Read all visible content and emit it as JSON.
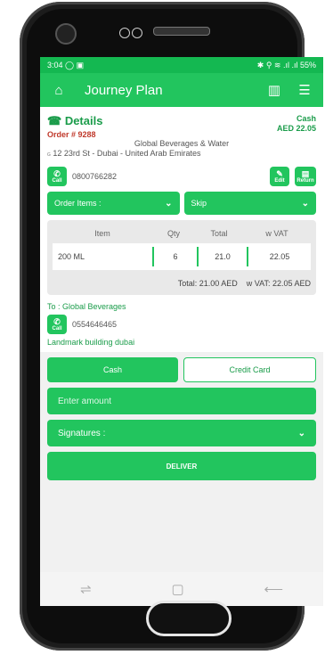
{
  "status_bar": {
    "time": "3:04",
    "left_icons": "◯ ▣",
    "right_text": "✱ ⚲ ≋ .ıl .ıl 55%"
  },
  "app_bar": {
    "title": "Journey Plan"
  },
  "details": {
    "title": "Details",
    "order_label": "Order # 9288",
    "payment_type": "Cash",
    "payment_amount": "AED 22.05",
    "customer": "Global Beverages & Water",
    "address_prefix": "G",
    "address": "12 23rd St - Dubai - United Arab Emirates",
    "phone": "0800766282",
    "call_label": "Call",
    "edit_label": "Edit",
    "return_label": "Return"
  },
  "dropdowns": {
    "order_items": "Order Items :",
    "skip": "Skip"
  },
  "items": {
    "headers": [
      "Item",
      "Qty",
      "Total",
      "w VAT"
    ],
    "rows": [
      {
        "item": "200 ML",
        "qty": "6",
        "total": "21.0",
        "vat": "22.05"
      }
    ],
    "total_text": "Total: 21.00 AED",
    "vat_text": "w VAT: 22.05 AED"
  },
  "recipient": {
    "to_label": "To : Global Beverages",
    "phone": "0554646465",
    "call_label": "Call",
    "landmark": "Landmark building dubai"
  },
  "payment_buttons": {
    "cash": "Cash",
    "credit": "Credit Card"
  },
  "amount_placeholder": "Enter amount",
  "signatures_label": "Signatures :",
  "deliver_label": "DELIVER",
  "colors": {
    "primary": "#22c55e",
    "status_bar": "#14b851",
    "order_no": "#c0392b"
  }
}
